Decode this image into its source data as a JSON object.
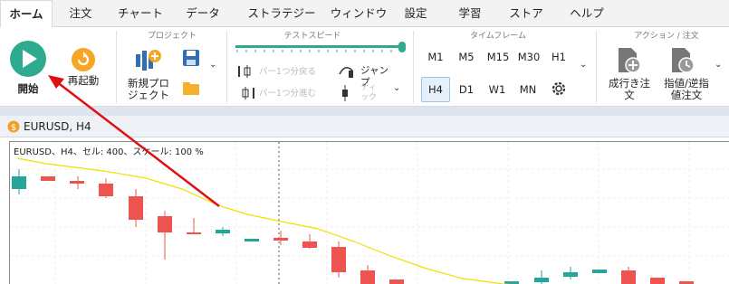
{
  "menu": {
    "tabs": [
      "ホーム",
      "注文",
      "チャート",
      "データ",
      "ストラテジー",
      "ウィンドウ",
      "設定",
      "学習",
      "ストア",
      "ヘルプ"
    ]
  },
  "ribbon": {
    "start_label": "開始",
    "restart_label": "再起動",
    "project_group": "プロジェクト",
    "new_project_label": "新規プロ\nジェクト",
    "speed_group": "テストスピード",
    "speed_level": 1.0,
    "back_one_label": "バー1つ分戻る",
    "forward_one_label": "バー1つ分進む",
    "jump_label": "ジャンプ",
    "tick_label": "ティ\nック",
    "timeframe_group": "タイムフレーム",
    "timeframes_row1": [
      "M1",
      "M5",
      "M15",
      "M30",
      "H1"
    ],
    "timeframes_row2": [
      "H4",
      "D1",
      "W1",
      "MN"
    ],
    "selected_timeframe": "H4",
    "action_group": "アクション / 注文",
    "market_order_label": "成行き注\n文",
    "limit_order_label": "指値/逆指\n値注文"
  },
  "chart": {
    "tab_title": "EURUSD, H4",
    "info_line": "EURUSD、H4、セル: 400、スケール: 100 %"
  },
  "chart_data": {
    "type": "candlestick",
    "series": [
      {
        "name": "MA",
        "color": "#f0e000"
      }
    ],
    "colors": {
      "up": "#26a69a",
      "down": "#ef5350"
    }
  },
  "colors": {
    "accent": "#2eaa8e",
    "restart": "#f5a623",
    "bull": "#26a69a",
    "bear": "#ef5350",
    "ma": "#f0e000",
    "arrow": "#e01010"
  }
}
